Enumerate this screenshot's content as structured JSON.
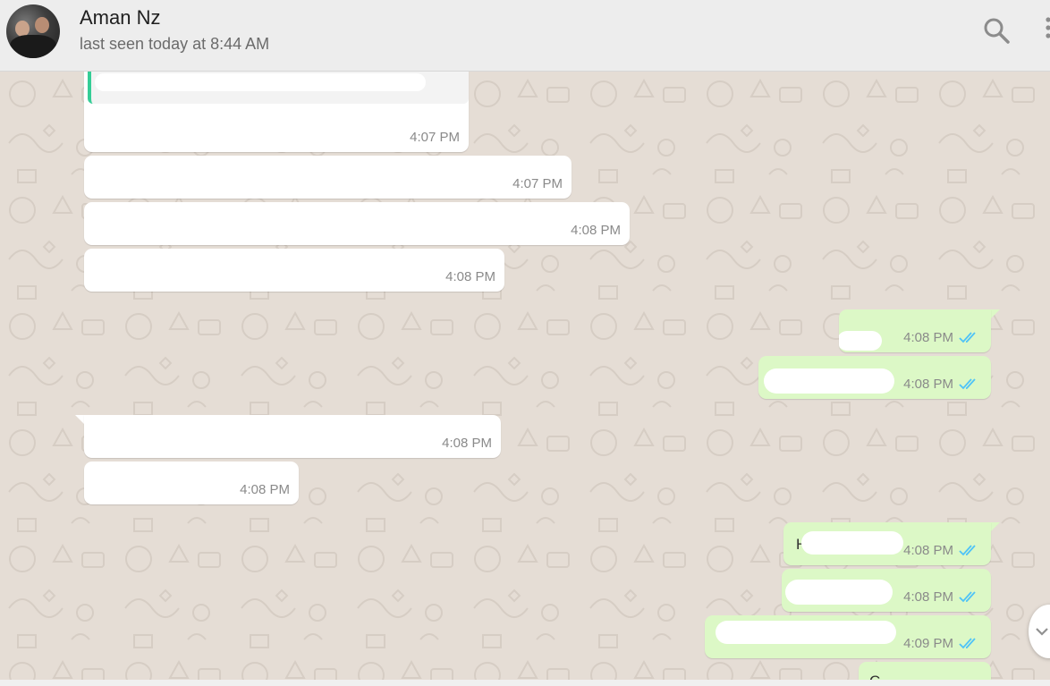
{
  "header": {
    "contact_name": "Aman Nz",
    "status": "last seen today at 8:44 AM",
    "search_icon": "search-icon",
    "menu_icon": "kebab-menu-icon"
  },
  "colors": {
    "background": "#e5ddd5",
    "incoming_bubble": "#ffffff",
    "outgoing_bubble": "#dcf8c6",
    "read_ticks": "#4fc3f7",
    "header": "#ededed"
  },
  "messages": [
    {
      "direction": "in",
      "text": "",
      "time": "4:07 PM"
    },
    {
      "direction": "in",
      "text": "",
      "time": "4:07 PM"
    },
    {
      "direction": "in",
      "text": "",
      "time": "4:08 PM"
    },
    {
      "direction": "in",
      "text": "",
      "time": "4:08 PM"
    },
    {
      "direction": "out",
      "text": "",
      "time": "4:08 PM",
      "status": "read"
    },
    {
      "direction": "out",
      "text": "",
      "time": "4:08 PM",
      "status": "read"
    },
    {
      "direction": "in",
      "text": "",
      "time": "4:08 PM"
    },
    {
      "direction": "in",
      "text": "",
      "time": "4:08 PM"
    },
    {
      "direction": "out",
      "text": "H",
      "time": "4:08 PM",
      "status": "read"
    },
    {
      "direction": "out",
      "text": "",
      "time": "4:08 PM",
      "status": "read"
    },
    {
      "direction": "out",
      "text": "",
      "time": "4:09 PM",
      "status": "read"
    },
    {
      "direction": "out",
      "text": "C",
      "time": "",
      "status": ""
    }
  ]
}
